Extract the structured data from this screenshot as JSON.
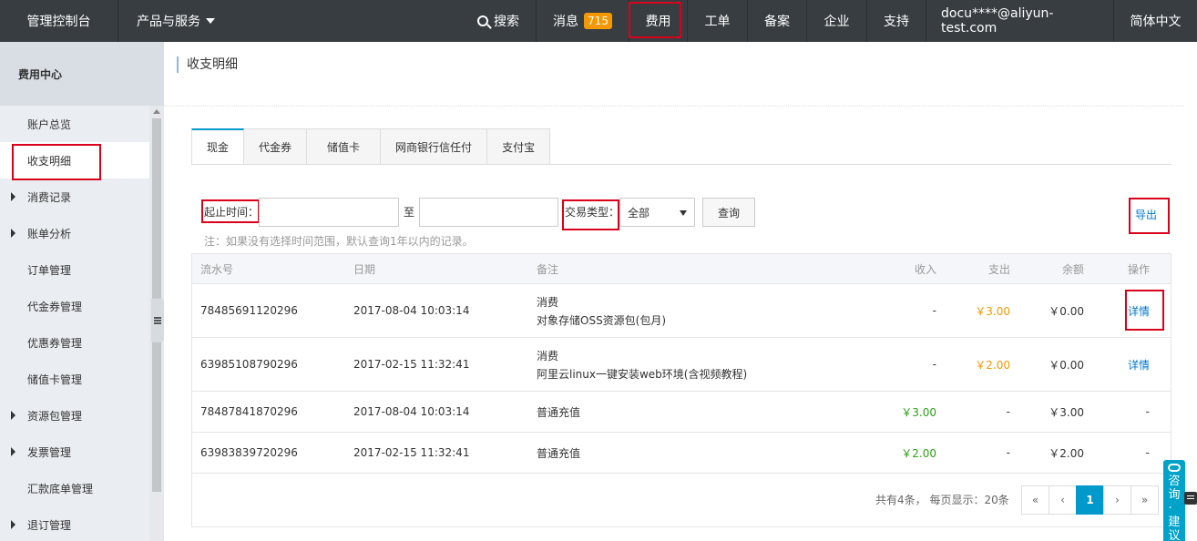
{
  "topbar": {
    "brand": "管理控制台",
    "products": "产品与服务",
    "search": "搜索",
    "messages": "消息",
    "message_count": "715",
    "fees": "费用",
    "tickets": "工单",
    "icp": "备案",
    "enterprise": "企业",
    "support": "支持",
    "account": "docu****@aliyun-test.com",
    "language": "简体中文"
  },
  "sidebar": {
    "title": "费用中心",
    "items": [
      {
        "label": "账户总览",
        "expandable": false
      },
      {
        "label": "收支明细",
        "expandable": false,
        "active": true
      },
      {
        "label": "消费记录",
        "expandable": true
      },
      {
        "label": "账单分析",
        "expandable": true
      },
      {
        "label": "订单管理",
        "expandable": false
      },
      {
        "label": "代金券管理",
        "expandable": false
      },
      {
        "label": "优惠券管理",
        "expandable": false
      },
      {
        "label": "储值卡管理",
        "expandable": false
      },
      {
        "label": "资源包管理",
        "expandable": true
      },
      {
        "label": "发票管理",
        "expandable": true
      },
      {
        "label": "汇款底单管理",
        "expandable": false
      },
      {
        "label": "退订管理",
        "expandable": true
      }
    ]
  },
  "main": {
    "title": "收支明细",
    "tabs": [
      "现金",
      "代金券",
      "储值卡",
      "网商银行信任付",
      "支付宝"
    ],
    "active_tab": "现金",
    "filters": {
      "start_label": "起止时间：",
      "to": "至",
      "type_label": "交易类型：",
      "type_value": "全部",
      "query_button": "查询",
      "export_link": "导出",
      "note": "注：如果没有选择时间范围，默认查询1年以内的记录。"
    },
    "table": {
      "headers": [
        "流水号",
        "日期",
        "备注",
        "收入",
        "支出",
        "余额",
        "操作"
      ],
      "rows": [
        {
          "id": "78485691120296",
          "date": "2017-08-04 10:03:14",
          "note1": "消费",
          "note2": "对象存储OSS资源包(包月)",
          "income": "-",
          "expense": "￥3.00",
          "balance": "￥0.00",
          "action": "详情"
        },
        {
          "id": "63985108790296",
          "date": "2017-02-15 11:32:41",
          "note1": "消费",
          "note2": "阿里云linux一键安装web环境(含视频教程)",
          "income": "-",
          "expense": "￥2.00",
          "balance": "￥0.00",
          "action": "详情"
        },
        {
          "id": "78487841870296",
          "date": "2017-08-04 10:03:14",
          "note1": "普通充值",
          "note2": "",
          "income": "￥3.00",
          "expense": "-",
          "balance": "￥3.00",
          "action": "-"
        },
        {
          "id": "63983839720296",
          "date": "2017-02-15 11:32:41",
          "note1": "普通充值",
          "note2": "",
          "income": "￥2.00",
          "expense": "-",
          "balance": "￥2.00",
          "action": "-"
        }
      ]
    },
    "pagination": {
      "info": "共有4条， 每页显示：20条",
      "first": "«",
      "prev": "‹",
      "current": "1",
      "next": "›",
      "last": "»"
    }
  },
  "float_widget": {
    "label": "咨询·建议"
  },
  "colors": {
    "topbar_bg": "#373d41",
    "highlight_red": "#d9001b",
    "accent_blue": "#0099cc",
    "expense_orange": "#f39800",
    "income_green": "#2d9f16"
  },
  "icons": [
    "search-icon",
    "chevron-down-icon",
    "chevron-right-icon",
    "collapse-sidebar-icon",
    "feedback-icon",
    "chat-icon"
  ]
}
